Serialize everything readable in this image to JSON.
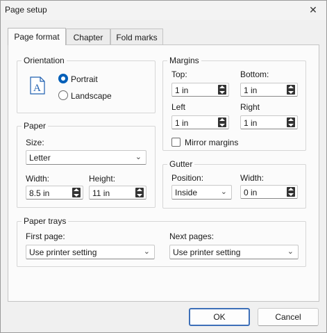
{
  "window": {
    "title": "Page setup"
  },
  "tabs": [
    {
      "label": "Page format",
      "active": true
    },
    {
      "label": "Chapter",
      "active": false
    },
    {
      "label": "Fold marks",
      "active": false
    }
  ],
  "orientation": {
    "title": "Orientation",
    "portrait_label": "Portrait",
    "landscape_label": "Landscape",
    "selected": "Portrait",
    "icon": "portrait-page-icon"
  },
  "paper": {
    "title": "Paper",
    "size_label": "Size:",
    "size_value": "Letter",
    "width_label": "Width:",
    "width_value": "8.5 in",
    "height_label": "Height:",
    "height_value": "11 in"
  },
  "margins": {
    "title": "Margins",
    "top_label": "Top:",
    "top_value": "1 in",
    "bottom_label": "Bottom:",
    "bottom_value": "1 in",
    "left_label": "Left",
    "left_value": "1 in",
    "right_label": "Right",
    "right_value": "1 in",
    "mirror_label": "Mirror margins",
    "mirror_checked": false
  },
  "gutter": {
    "title": "Gutter",
    "position_label": "Position:",
    "position_value": "Inside",
    "width_label": "Width:",
    "width_value": "0 in"
  },
  "trays": {
    "title": "Paper trays",
    "first_label": "First page:",
    "first_value": "Use printer setting",
    "next_label": "Next pages:",
    "next_value": "Use printer setting"
  },
  "buttons": {
    "ok": "OK",
    "cancel": "Cancel"
  },
  "colors": {
    "accent": "#005fb8",
    "ok_border": "#3d6fb8",
    "icon_blue": "#1f5fb0"
  }
}
